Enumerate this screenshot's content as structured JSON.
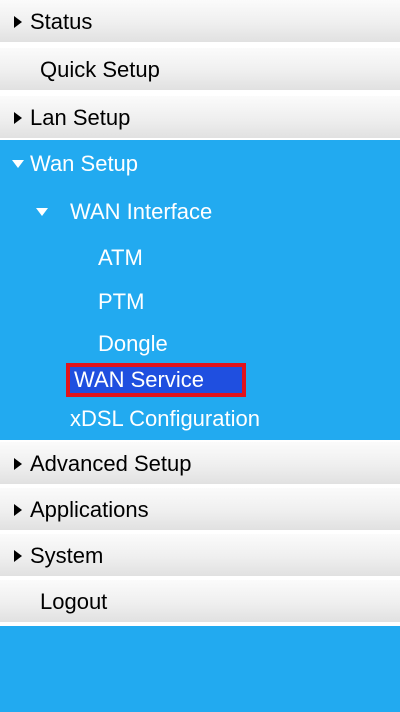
{
  "menu": {
    "status": "Status",
    "quick_setup": "Quick Setup",
    "lan_setup": "Lan Setup",
    "wan_setup": "Wan Setup",
    "wan_interface": "WAN Interface",
    "atm": "ATM",
    "ptm": "PTM",
    "dongle": "Dongle",
    "wan_service": "WAN Service",
    "xdsl_configuration": "xDSL Configuration",
    "advanced_setup": "Advanced Setup",
    "applications": "Applications",
    "system": "System",
    "logout": "Logout"
  },
  "colors": {
    "accent": "#22aaf0",
    "highlight_border": "#e1131b",
    "selected_background": "#1f4fe0"
  },
  "icons": {
    "collapsed": "triangle-right-icon",
    "expanded": "triangle-down-icon"
  }
}
